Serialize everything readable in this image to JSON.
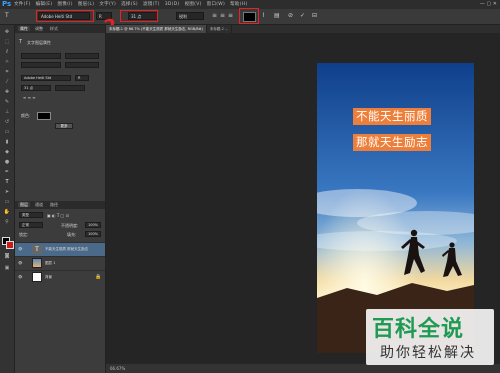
{
  "app": {
    "logo": "Ps"
  },
  "menu": {
    "items": [
      "文件(F)",
      "编辑(E)",
      "图像(I)",
      "图层(L)",
      "文字(Y)",
      "选择(S)",
      "滤镜(T)",
      "3D(D)",
      "视图(V)",
      "窗口(W)",
      "帮助(H)"
    ],
    "window_controls": "— ▢ ✕"
  },
  "options": {
    "tool_icon": "T",
    "font_family": "Adobe Heiti Std",
    "font_style": "R",
    "font_size": "31 点",
    "antialias": "锐利",
    "color_swatch": "#000000",
    "commit": "✓",
    "cancel": "⊘"
  },
  "annotations": {
    "a1": "2",
    "a2": "3",
    "a3": "4",
    "a4": "1"
  },
  "panel": {
    "tabs": [
      "属性",
      "调整",
      "样式"
    ],
    "title": "文字图层属性",
    "font_family": "Adobe Heiti Std",
    "font_style": "R",
    "font_size": "31 点",
    "color_label": "颜色:",
    "button": "更多"
  },
  "layers_panel": {
    "tabs": [
      "图层",
      "通道",
      "路径"
    ],
    "kind": "类型",
    "blend": "正常",
    "opacity_label": "不透明度:",
    "opacity": "100%",
    "lock_label": "锁定:",
    "fill_label": "填充:",
    "fill": "100%",
    "layers": [
      {
        "name": "不能天生丽质 那就天生励志",
        "type": "text"
      },
      {
        "name": "图层 1",
        "type": "image"
      },
      {
        "name": "背景",
        "type": "background"
      }
    ]
  },
  "document": {
    "tabs": [
      "未标题-1 @ 66.7% (不能天生丽质 那就天生励志, RGB/8#)",
      "未标题-2 ..."
    ],
    "zoom": "66.67%"
  },
  "canvas": {
    "line1": "不能天生丽质",
    "line2": "那就天生励志"
  },
  "watermark": {
    "big": "百科全说",
    "small": "助你轻松解决"
  }
}
